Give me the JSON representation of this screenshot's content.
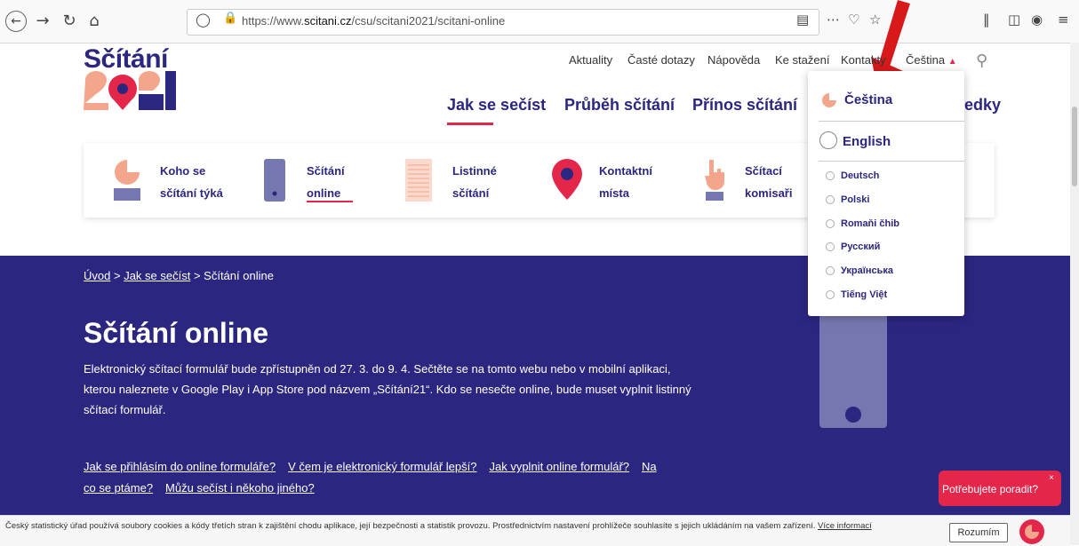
{
  "browser": {
    "url_prefix": "https://www.",
    "url_domain": "scitani.cz",
    "url_path": "/csu/scitani2021/scitani-online"
  },
  "site": {
    "logo_text": "Sčítání",
    "top_nav": [
      "Aktuality",
      "Časté dotazy",
      "Nápověda",
      "Ke stažení",
      "Kontakty",
      "Čeština"
    ],
    "main_nav": [
      "Jak se sečíst",
      "Průběh sčítání",
      "Přínos sčítání",
      "edky"
    ],
    "sub_nav": [
      {
        "line1": "Koho se",
        "line2": "sčítání týká"
      },
      {
        "line1": "Sčítání",
        "line2": "online"
      },
      {
        "line1": "Listinné",
        "line2": "sčítání"
      },
      {
        "line1": "Kontaktní",
        "line2": "místa"
      },
      {
        "line1": "Sčítací",
        "line2": "komisaři"
      }
    ]
  },
  "hero": {
    "breadcrumb": [
      "Úvod",
      "Jak se sečíst",
      "Sčítání online"
    ],
    "title": "Sčítání online",
    "text": "Elektronický sčítací formulář bude zpřístupněn od 27. 3. do 9. 4.  Sečtěte se na tomto webu nebo v mobilní aplikaci, kterou naleznete v Google Play i App Store pod názvem „Sčítání21“. Kdo se nesečte online, bude muset vyplnit listinný sčítací formulář.",
    "links": [
      "Jak se přihlásím do online formuláře?",
      "V čem je elektronický formulář lepší?",
      "Jak vyplnit online formulář?",
      "Na co se ptáme?",
      "Můžu sečíst i někoho jiného?"
    ]
  },
  "language_menu": {
    "selected": "Čeština",
    "big": [
      "Čeština",
      "English"
    ],
    "small": [
      "Deutsch",
      "Polski",
      "Romaňi čhib",
      "Русский",
      "Українська",
      "Tiếng Việt"
    ]
  },
  "cookie": {
    "text": "Český statistický úřad používá soubory cookies a kódy třetích stran k zajištění chodu aplikace, její bezpečnosti a statistik provozu. Prostřednictvím nastavení prohlížeče souhlasíte s jejich ukládáním na vašem zařízení.",
    "more": "Více informací",
    "accept": "Rozumím"
  },
  "chat": {
    "label": "Potřebujete poradit?",
    "close": "×"
  },
  "colors": {
    "brand_blue": "#2b2680",
    "brand_red": "#e4264a",
    "brand_peach": "#f4a68c"
  }
}
